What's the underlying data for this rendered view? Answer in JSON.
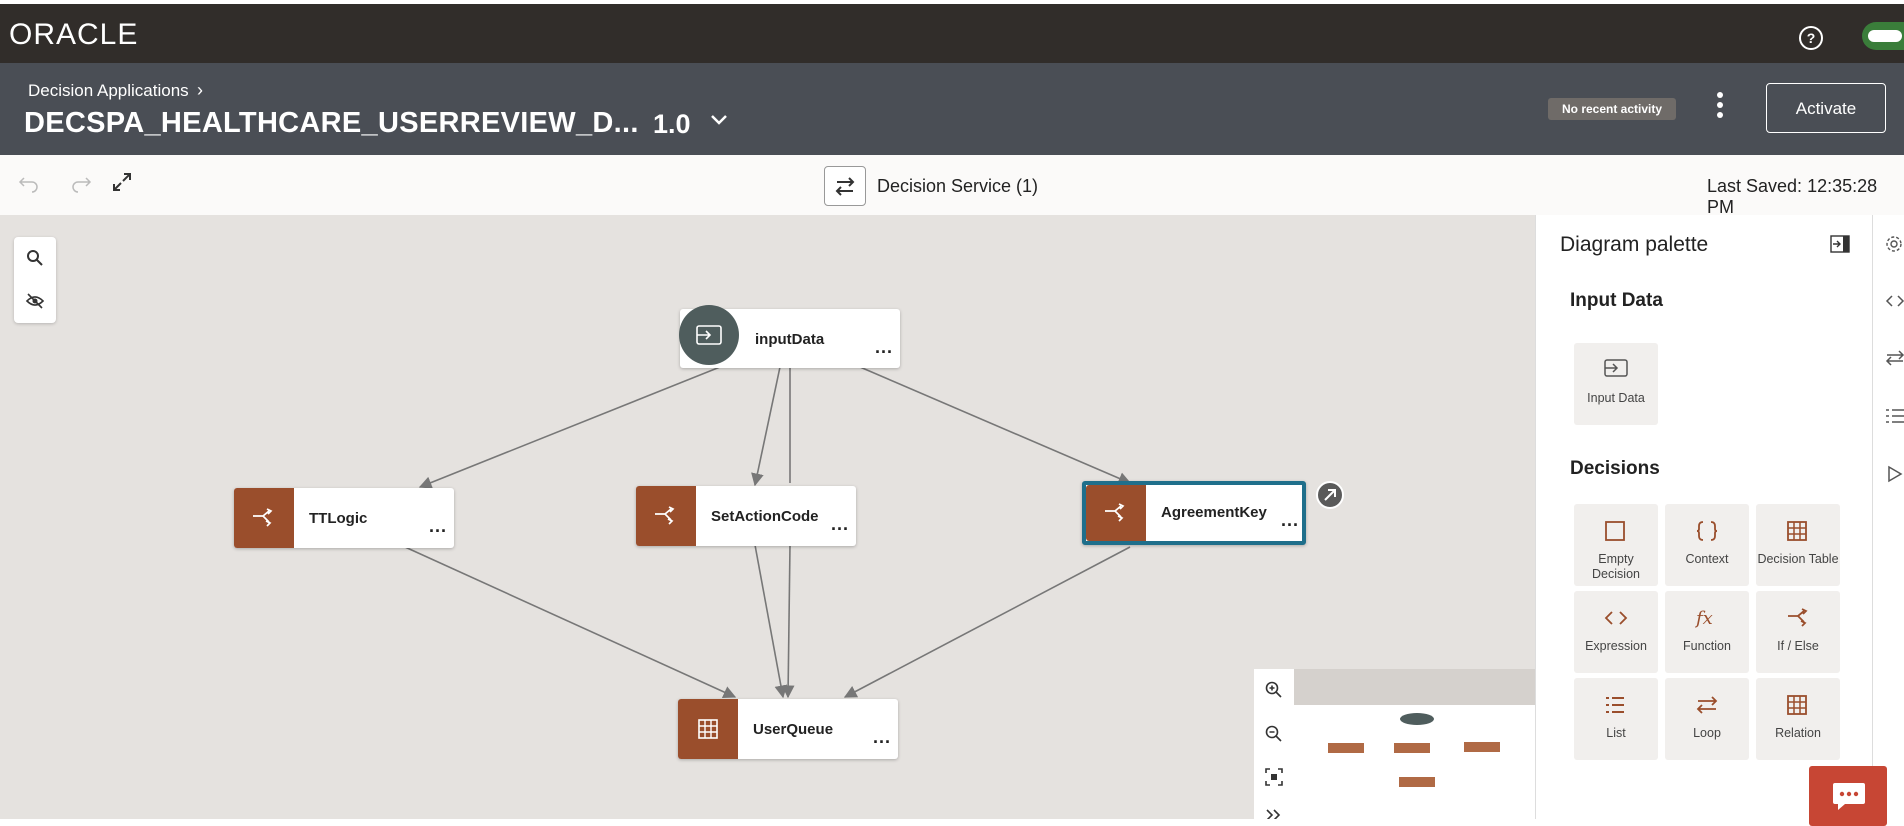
{
  "topbar": {
    "logo": "ORACLE",
    "help": "?"
  },
  "header": {
    "breadcrumb": "Decision Applications",
    "breadcrumb_chevron": "›",
    "title": "DECSPA_HEALTHCARE_USERREVIEW_D...",
    "version": "1.0",
    "activity": "No recent activity",
    "activate_label": "Activate"
  },
  "toolbar": {
    "decision_service": "Decision Service (1)",
    "last_saved": "Last Saved: 12:35:28 PM"
  },
  "diagram": {
    "nodes": {
      "input": "inputData",
      "ttlogic": "TTLogic",
      "setaction": "SetActionCode",
      "agreement": "AgreementKey",
      "userqueue": "UserQueue"
    },
    "more": "..."
  },
  "palette": {
    "title": "Diagram palette",
    "input_section": "Input Data",
    "input_tile": "Input Data",
    "decisions_section": "Decisions",
    "tiles": {
      "empty": "Empty Decision",
      "context": "Context",
      "table": "Decision Table",
      "expression": "Expression",
      "function": "Function",
      "ifelse": "If / Else",
      "list": "List",
      "loop": "Loop",
      "relation": "Relation"
    }
  },
  "colors": {
    "decision_node": "#9a4e2c",
    "topbar": "#312d2a",
    "header": "#4a4e55",
    "selected": "#1f6f8b"
  }
}
